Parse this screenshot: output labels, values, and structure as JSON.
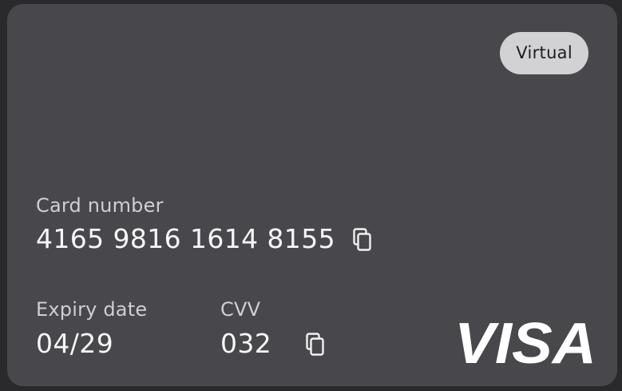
{
  "card": {
    "badge": "Virtual",
    "number_label": "Card number",
    "number_value": "4165 9816 1614 8155",
    "expiry_label": "Expiry date",
    "expiry_value": "04/29",
    "cvv_label": "CVV",
    "cvv_value": "032",
    "brand": "VISA"
  },
  "icons": {
    "copy_number": "copy-icon",
    "copy_cvv": "copy-icon"
  },
  "colors": {
    "card_bg": "#48484c",
    "page_bg": "#2a2a2c",
    "badge_bg": "#d2d2d4",
    "text_primary": "#f6f6f8",
    "text_secondary": "#cfcfd3"
  }
}
